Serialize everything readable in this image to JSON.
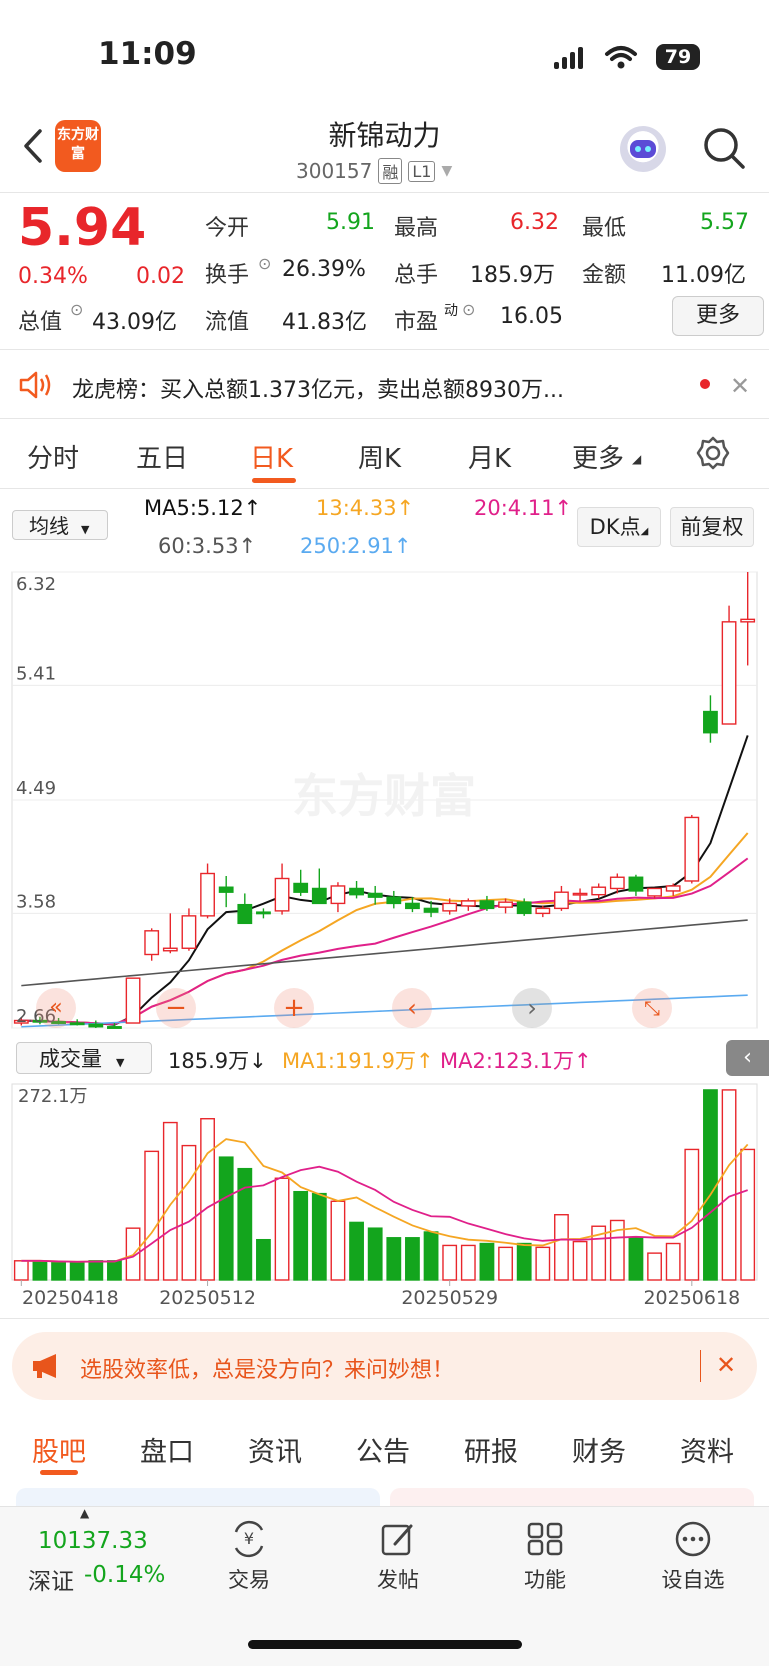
{
  "status": {
    "time": "11:09",
    "battery": "79"
  },
  "header": {
    "title": "新锦动力",
    "code": "300157",
    "tag_margin": "融",
    "tag_level": "L1",
    "logo": "东方财富"
  },
  "quote": {
    "price": "5.94",
    "change_pct": "0.34%",
    "change_amt": "0.02",
    "open_label": "今开",
    "open": "5.91",
    "high_label": "最高",
    "high": "6.32",
    "low_label": "最低",
    "low": "5.57",
    "turnover_label": "换手",
    "turnover": "26.39%",
    "volume_label": "总手",
    "volume": "185.9万",
    "amount_label": "金额",
    "amount": "11.09亿",
    "mktcap_label": "总值",
    "mktcap": "43.09亿",
    "float_label": "流值",
    "float_cap": "41.83亿",
    "pe_label": "市盈",
    "pe_sup": "动",
    "pe": "16.05",
    "more_button": "更多"
  },
  "notice": {
    "text": "龙虎榜：买入总额1.373亿元，卖出总额8930万..."
  },
  "period_tabs": [
    {
      "label": "分时"
    },
    {
      "label": "五日"
    },
    {
      "label": "日K"
    },
    {
      "label": "周K"
    },
    {
      "label": "月K"
    },
    {
      "label": "更多"
    }
  ],
  "ma_bar": {
    "dropdown": "均线",
    "ma5": "MA5:5.12↑",
    "ma13": "13:4.33↑",
    "ma20": "20:4.11↑",
    "ma60": "60:3.53↑",
    "ma250": "250:2.91↑",
    "dk_button": "DK点",
    "adjust_button": "前复权"
  },
  "chart_data": {
    "type": "candlestick",
    "y_ticks": [
      "6.32",
      "5.41",
      "4.49",
      "3.58",
      "2.66"
    ],
    "ylim": [
      2.66,
      6.32
    ],
    "x_labels": [
      "20250418",
      "20250512",
      "20250529",
      "20250618"
    ],
    "volume_max_label": "272.1万",
    "volume_label": "成交量",
    "volume_current": "185.9万↓",
    "vol_ma1": "MA1:191.9万↑",
    "vol_ma2": "MA2:123.1万↑",
    "colors": {
      "up": "#e8262b",
      "down": "#13a51d",
      "ma5": "#111111",
      "ma13": "#f5a623",
      "ma20": "#e0208a",
      "ma60": "#555555",
      "ma250": "#5aaaf0"
    },
    "candles": [
      {
        "o": 2.7,
        "h": 2.74,
        "l": 2.68,
        "c": 2.72,
        "v": 10
      },
      {
        "o": 2.72,
        "h": 2.75,
        "l": 2.69,
        "c": 2.71,
        "v": 10
      },
      {
        "o": 2.71,
        "h": 2.74,
        "l": 2.69,
        "c": 2.7,
        "v": 9
      },
      {
        "o": 2.7,
        "h": 2.73,
        "l": 2.68,
        "c": 2.69,
        "v": 9
      },
      {
        "o": 2.69,
        "h": 2.72,
        "l": 2.66,
        "c": 2.67,
        "v": 10
      },
      {
        "o": 2.67,
        "h": 2.7,
        "l": 2.66,
        "c": 2.66,
        "v": 10
      },
      {
        "o": 2.7,
        "h": 3.06,
        "l": 2.7,
        "c": 3.06,
        "v": 27
      },
      {
        "o": 3.25,
        "h": 3.46,
        "l": 3.2,
        "c": 3.44,
        "v": 67
      },
      {
        "o": 3.28,
        "h": 3.58,
        "l": 3.26,
        "c": 3.3,
        "v": 82
      },
      {
        "o": 3.3,
        "h": 3.62,
        "l": 3.28,
        "c": 3.56,
        "v": 70
      },
      {
        "o": 3.56,
        "h": 3.98,
        "l": 3.54,
        "c": 3.9,
        "v": 84
      },
      {
        "o": 3.79,
        "h": 3.88,
        "l": 3.63,
        "c": 3.75,
        "v": 64
      },
      {
        "o": 3.65,
        "h": 3.74,
        "l": 3.55,
        "c": 3.5,
        "v": 58
      },
      {
        "o": 3.59,
        "h": 3.62,
        "l": 3.54,
        "c": 3.58,
        "v": 21
      },
      {
        "o": 3.6,
        "h": 3.98,
        "l": 3.57,
        "c": 3.86,
        "v": 53
      },
      {
        "o": 3.82,
        "h": 3.93,
        "l": 3.72,
        "c": 3.75,
        "v": 46
      },
      {
        "o": 3.78,
        "h": 3.94,
        "l": 3.7,
        "c": 3.66,
        "v": 45
      },
      {
        "o": 3.66,
        "h": 3.83,
        "l": 3.59,
        "c": 3.8,
        "v": 41
      },
      {
        "o": 3.78,
        "h": 3.84,
        "l": 3.7,
        "c": 3.73,
        "v": 30
      },
      {
        "o": 3.74,
        "h": 3.8,
        "l": 3.65,
        "c": 3.71,
        "v": 27
      },
      {
        "o": 3.71,
        "h": 3.76,
        "l": 3.62,
        "c": 3.66,
        "v": 22
      },
      {
        "o": 3.66,
        "h": 3.71,
        "l": 3.59,
        "c": 3.62,
        "v": 22
      },
      {
        "o": 3.62,
        "h": 3.68,
        "l": 3.55,
        "c": 3.59,
        "v": 25
      },
      {
        "o": 3.6,
        "h": 3.7,
        "l": 3.57,
        "c": 3.66,
        "v": 18
      },
      {
        "o": 3.64,
        "h": 3.7,
        "l": 3.6,
        "c": 3.68,
        "v": 18
      },
      {
        "o": 3.68,
        "h": 3.72,
        "l": 3.6,
        "c": 3.62,
        "v": 19
      },
      {
        "o": 3.63,
        "h": 3.7,
        "l": 3.58,
        "c": 3.67,
        "v": 17
      },
      {
        "o": 3.67,
        "h": 3.7,
        "l": 3.56,
        "c": 3.58,
        "v": 19
      },
      {
        "o": 3.58,
        "h": 3.64,
        "l": 3.55,
        "c": 3.62,
        "v": 17
      },
      {
        "o": 3.62,
        "h": 3.8,
        "l": 3.6,
        "c": 3.75,
        "v": 34
      },
      {
        "o": 3.73,
        "h": 3.78,
        "l": 3.68,
        "c": 3.74,
        "v": 20
      },
      {
        "o": 3.73,
        "h": 3.82,
        "l": 3.7,
        "c": 3.79,
        "v": 28
      },
      {
        "o": 3.78,
        "h": 3.9,
        "l": 3.74,
        "c": 3.87,
        "v": 31
      },
      {
        "o": 3.87,
        "h": 3.89,
        "l": 3.72,
        "c": 3.76,
        "v": 22
      },
      {
        "o": 3.72,
        "h": 3.78,
        "l": 3.7,
        "c": 3.78,
        "v": 14
      },
      {
        "o": 3.76,
        "h": 3.82,
        "l": 3.72,
        "c": 3.8,
        "v": 19
      },
      {
        "o": 3.84,
        "h": 4.37,
        "l": 3.82,
        "c": 4.35,
        "v": 68
      },
      {
        "o": 5.2,
        "h": 5.33,
        "l": 4.95,
        "c": 5.03,
        "v": 99
      },
      {
        "o": 5.1,
        "h": 6.05,
        "l": 5.1,
        "c": 5.92,
        "v": 99
      },
      {
        "o": 5.92,
        "h": 6.32,
        "l": 5.57,
        "c": 5.94,
        "v": 68
      }
    ]
  },
  "chart_controls": [
    "first-page",
    "zoom-out",
    "zoom-in",
    "prev",
    "next",
    "fullscreen"
  ],
  "ad": {
    "text": "选股效率低，总是没方向？来问妙想！"
  },
  "bottom_tabs": [
    {
      "label": "股吧"
    },
    {
      "label": "盘口"
    },
    {
      "label": "资讯"
    },
    {
      "label": "公告"
    },
    {
      "label": "研报"
    },
    {
      "label": "财务"
    },
    {
      "label": "资料"
    }
  ],
  "index": {
    "value": "10137.33",
    "name": "深证",
    "change": "-0.14%"
  },
  "bottom_nav": [
    {
      "label": "交易"
    },
    {
      "label": "发帖"
    },
    {
      "label": "功能"
    },
    {
      "label": "设自选"
    }
  ]
}
